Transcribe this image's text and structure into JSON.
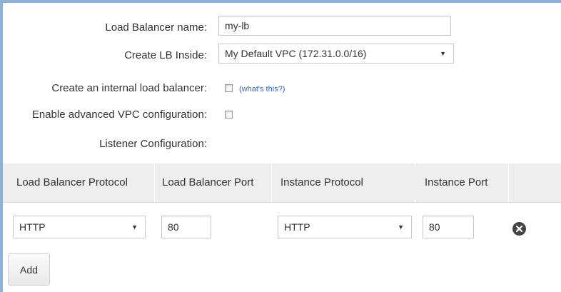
{
  "form": {
    "lb_name_label": "Load Balancer name:",
    "lb_name_value": "my-lb",
    "create_inside_label": "Create LB Inside:",
    "create_inside_value": "My Default VPC (172.31.0.0/16)",
    "internal_label": "Create an internal load balancer:",
    "internal_help_link": "(what's this?)",
    "internal_checked": false,
    "advanced_vpc_label": "Enable advanced VPC configuration:",
    "advanced_vpc_checked": false,
    "listener_label": "Listener Configuration:"
  },
  "listeners": {
    "columns": [
      "Load Balancer Protocol",
      "Load Balancer Port",
      "Instance Protocol",
      "Instance Port"
    ],
    "rows": [
      {
        "lb_protocol": "HTTP",
        "lb_port": "80",
        "instance_protocol": "HTTP",
        "instance_port": "80"
      }
    ]
  },
  "actions": {
    "add_label": "Add",
    "remove_icon": "remove-circle-icon"
  },
  "colors": {
    "frame": "#8fb0d8",
    "header_bg": "#eeeeee",
    "link": "#3366cc"
  }
}
